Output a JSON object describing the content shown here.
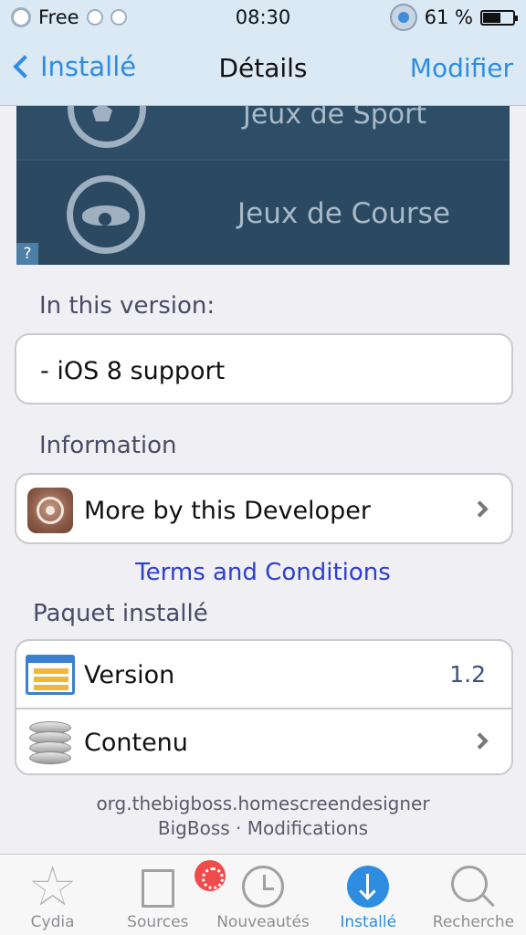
{
  "status_bar": {
    "carrier": "Free",
    "time": "08:30",
    "battery_percent": "61 %",
    "battery_level": 0.61
  },
  "nav": {
    "back_label": "Installé",
    "title": "Détails",
    "edit_label": "Modifier"
  },
  "screenshot": {
    "row1_label": "Jeux de Sport",
    "row2_label": "Jeux de Course",
    "help_glyph": "?"
  },
  "version_section": {
    "title": "In this version:",
    "notes": "- iOS 8 support"
  },
  "information_section": {
    "title": "Information",
    "more_by_developer": "More by this Developer"
  },
  "terms_link": "Terms and Conditions",
  "installed_section": {
    "title": "Paquet installé",
    "version_label": "Version",
    "version_value": "1.2",
    "contents_label": "Contenu"
  },
  "footer": {
    "package_id": "org.thebigboss.homescreendesigner",
    "source_and_section": "BigBoss · Modifications"
  },
  "tabs": [
    {
      "label": "Cydia",
      "icon": "star-icon"
    },
    {
      "label": "Sources",
      "icon": "sources-icon"
    },
    {
      "label": "Nouveautés",
      "icon": "clock-icon"
    },
    {
      "label": "Installé",
      "icon": "download-icon"
    },
    {
      "label": "Recherche",
      "icon": "search-icon"
    }
  ],
  "colors": {
    "accent": "#2e8de0",
    "link": "#2c3fd0",
    "bar_background": "#dbe9f5"
  }
}
